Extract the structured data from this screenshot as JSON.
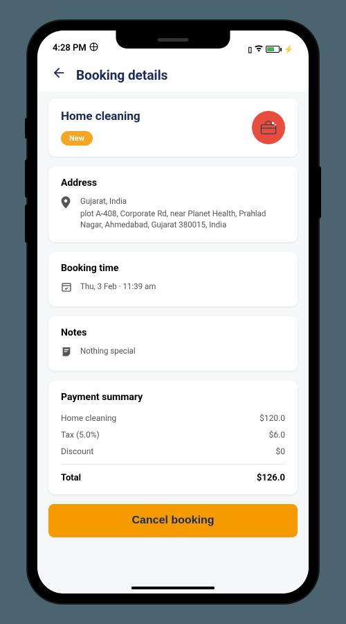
{
  "status_bar": {
    "time": "4:28 PM",
    "battery_icon": "battery-icon",
    "lightning": "⚡"
  },
  "header": {
    "title": "Booking details"
  },
  "service": {
    "title": "Home cleaning",
    "badge": "New"
  },
  "address": {
    "heading": "Address",
    "line1": "Gujarat, India",
    "line2": "plot A-408, Corporate Rd, near Planet Health, Prahlad Nagar, Ahmedabad, Gujarat 380015, India"
  },
  "booking_time": {
    "heading": "Booking time",
    "value": "Thu, 3 Feb · 11:39 am"
  },
  "notes": {
    "heading": "Notes",
    "value": "Nothing special"
  },
  "payment": {
    "heading": "Payment summary",
    "rows": [
      {
        "label": "Home cleaning",
        "value": "$120.0"
      },
      {
        "label": "Tax (5.0%)",
        "value": "$6.0"
      },
      {
        "label": "Discount",
        "value": "$0"
      }
    ],
    "total_label": "Total",
    "total_value": "$126.0"
  },
  "cancel_button": "Cancel booking"
}
